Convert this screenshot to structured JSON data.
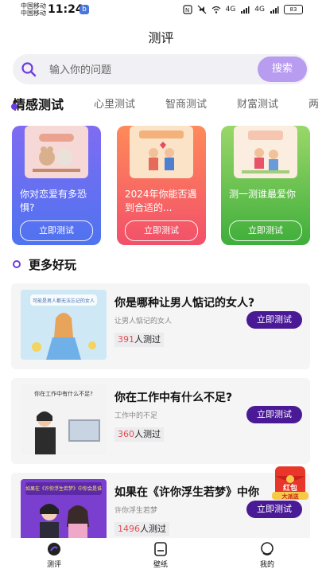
{
  "status_bar": {
    "carrier1": "中国移动",
    "carrier2": "中国移动",
    "time": "11:24",
    "app_badge": "b",
    "signal1": "4G",
    "signal2": "4G",
    "battery": "83"
  },
  "header": {
    "title": "测评"
  },
  "search": {
    "placeholder": "输入你的问题",
    "button": "搜索"
  },
  "tabs": [
    {
      "label": "情感测试",
      "active": true
    },
    {
      "label": "心里测试"
    },
    {
      "label": "智商测试"
    },
    {
      "label": "财富测试"
    },
    {
      "label": "两"
    }
  ],
  "cards": [
    {
      "text": "你对恋爱有多恐惧?",
      "button": "立即测试",
      "color": "#5b6cf0"
    },
    {
      "text": "2024年你能否遇到合适的...",
      "button": "立即测试",
      "color": "#f56a4a"
    },
    {
      "text": "测一测谁最爱你",
      "button": "立即测试",
      "color": "#5fbf46"
    }
  ],
  "more": {
    "title": "更多好玩"
  },
  "items": [
    {
      "title": "你是哪种让男人惦记的女人?",
      "subtitle": "让男人惦记的女人",
      "count": "391",
      "count_suffix": "人测过",
      "button": "立即测试"
    },
    {
      "title": "你在工作中有什么不足?",
      "subtitle": "工作中的不足",
      "count": "360",
      "count_suffix": "人测过",
      "button": "立即测试"
    },
    {
      "title": "如果在《许你浮生若梦》中你",
      "subtitle": "许你浮生若梦",
      "count": "1496",
      "count_suffix": "人测过",
      "button": "立即测试"
    }
  ],
  "item_images": [
    {
      "caption": "可能是男人都无法忘记的女人"
    },
    {
      "caption": "你在工作中有什么不足?"
    },
    {
      "caption": "如果在《许你浮生若梦》中你会是谁"
    }
  ],
  "red_packet": {
    "line1": "红包",
    "line2": "大派送"
  },
  "nav": [
    {
      "label": "测评",
      "active": true
    },
    {
      "label": "壁纸"
    },
    {
      "label": "我的"
    }
  ]
}
